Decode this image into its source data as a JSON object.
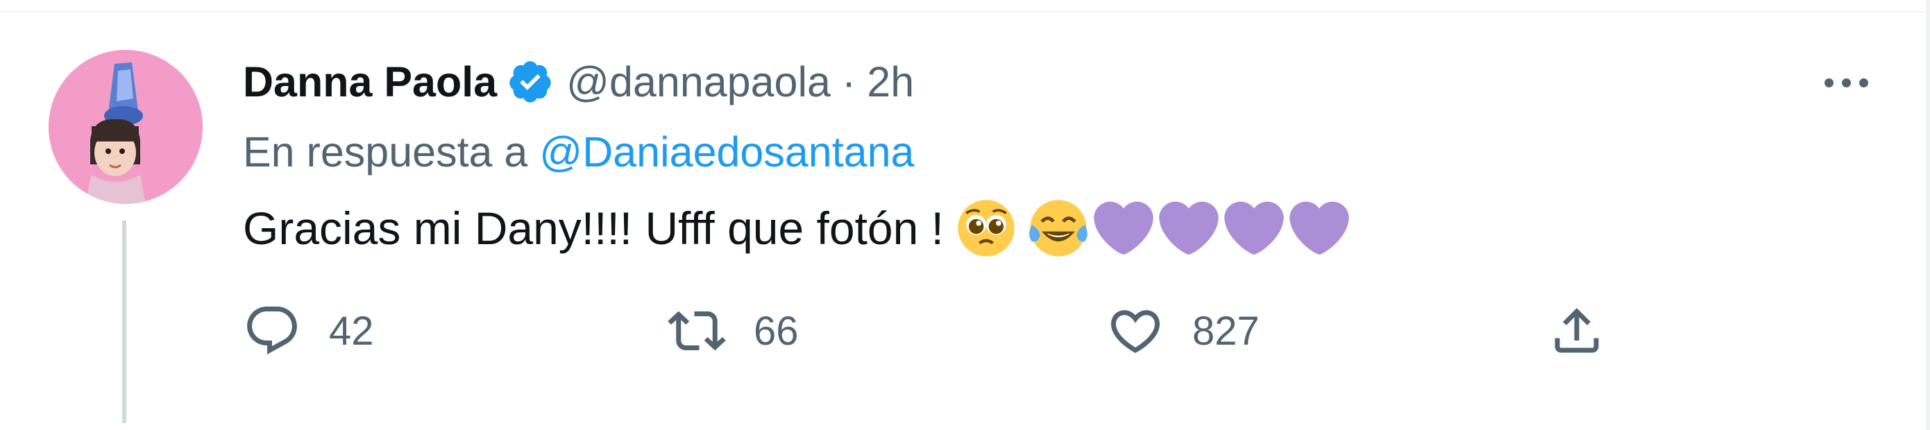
{
  "tweet": {
    "author_name": "Danna Paola",
    "handle": "@dannapaola",
    "separator": "·",
    "time": "2h",
    "reply_prefix": "En respuesta a",
    "reply_to": "@Daniaedosantana",
    "text": "Gracias mi Dany!!!! Ufff que fotón !",
    "emojis": [
      "pleading-face-emoji",
      "tears-of-joy-emoji",
      "purple-heart-emoji",
      "purple-heart-emoji",
      "purple-heart-emoji",
      "purple-heart-emoji"
    ]
  },
  "actions": {
    "reply_count": "42",
    "retweet_count": "66",
    "like_count": "827"
  },
  "colors": {
    "accent": "#1d9bf0",
    "secondary_text": "#536471",
    "primary_text": "#0f1419",
    "heart": "#a688d6",
    "avatar_bg": "#f39cc8"
  },
  "icons": [
    "verified-badge-icon",
    "more-icon",
    "reply-icon",
    "retweet-icon",
    "like-icon",
    "share-icon"
  ]
}
